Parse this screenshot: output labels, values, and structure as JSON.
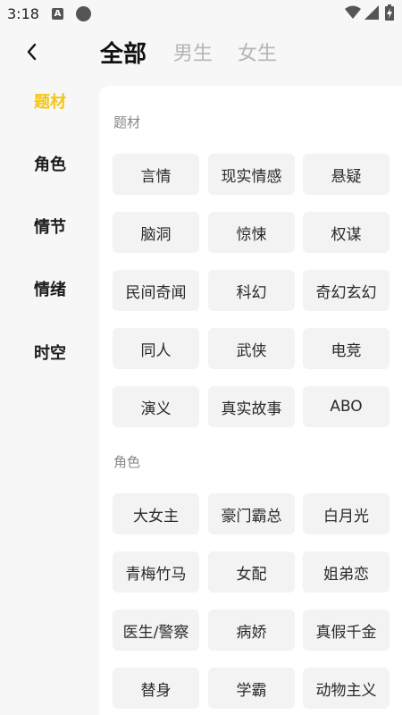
{
  "status": {
    "time": "3:18",
    "app_icon_letter": "A"
  },
  "tabs": [
    {
      "label": "全部",
      "active": true
    },
    {
      "label": "男生",
      "active": false
    },
    {
      "label": "女生",
      "active": false
    }
  ],
  "sidebar": {
    "active_color": "#f2c617",
    "items": [
      {
        "label": "题材",
        "active": true
      },
      {
        "label": "角色",
        "active": false
      },
      {
        "label": "情节",
        "active": false
      },
      {
        "label": "情绪",
        "active": false
      },
      {
        "label": "时空",
        "active": false
      }
    ]
  },
  "sections": [
    {
      "title": "题材",
      "tags": [
        "言情",
        "现实情感",
        "悬疑",
        "脑洞",
        "惊悚",
        "权谋",
        "民间奇闻",
        "科幻",
        "奇幻玄幻",
        "同人",
        "武侠",
        "电竞",
        "演义",
        "真实故事",
        "ABO"
      ]
    },
    {
      "title": "角色",
      "tags": [
        "大女主",
        "豪门霸总",
        "白月光",
        "青梅竹马",
        "女配",
        "姐弟恋",
        "医生/警察",
        "病娇",
        "真假千金",
        "替身",
        "学霸",
        "动物主义"
      ]
    }
  ]
}
